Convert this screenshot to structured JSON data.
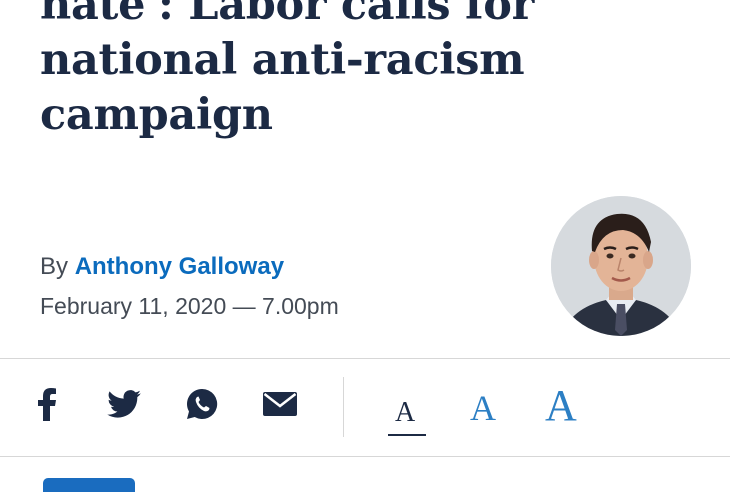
{
  "article": {
    "headline": "hate': Labor calls for national anti-racism campaign",
    "byline_prefix": "By",
    "author": "Anthony Galloway",
    "date": "February 11, 2020 — 7.00pm"
  },
  "share": {
    "icons": [
      "facebook-icon",
      "twitter-icon",
      "whatsapp-icon",
      "email-icon"
    ]
  },
  "font_size": {
    "small": "A",
    "medium": "A",
    "large": "A",
    "selected": "small"
  },
  "colors": {
    "headline": "#1c2a44",
    "author_link": "#0b6bbd",
    "accent": "#2c7fc4",
    "text": "#444b55"
  }
}
